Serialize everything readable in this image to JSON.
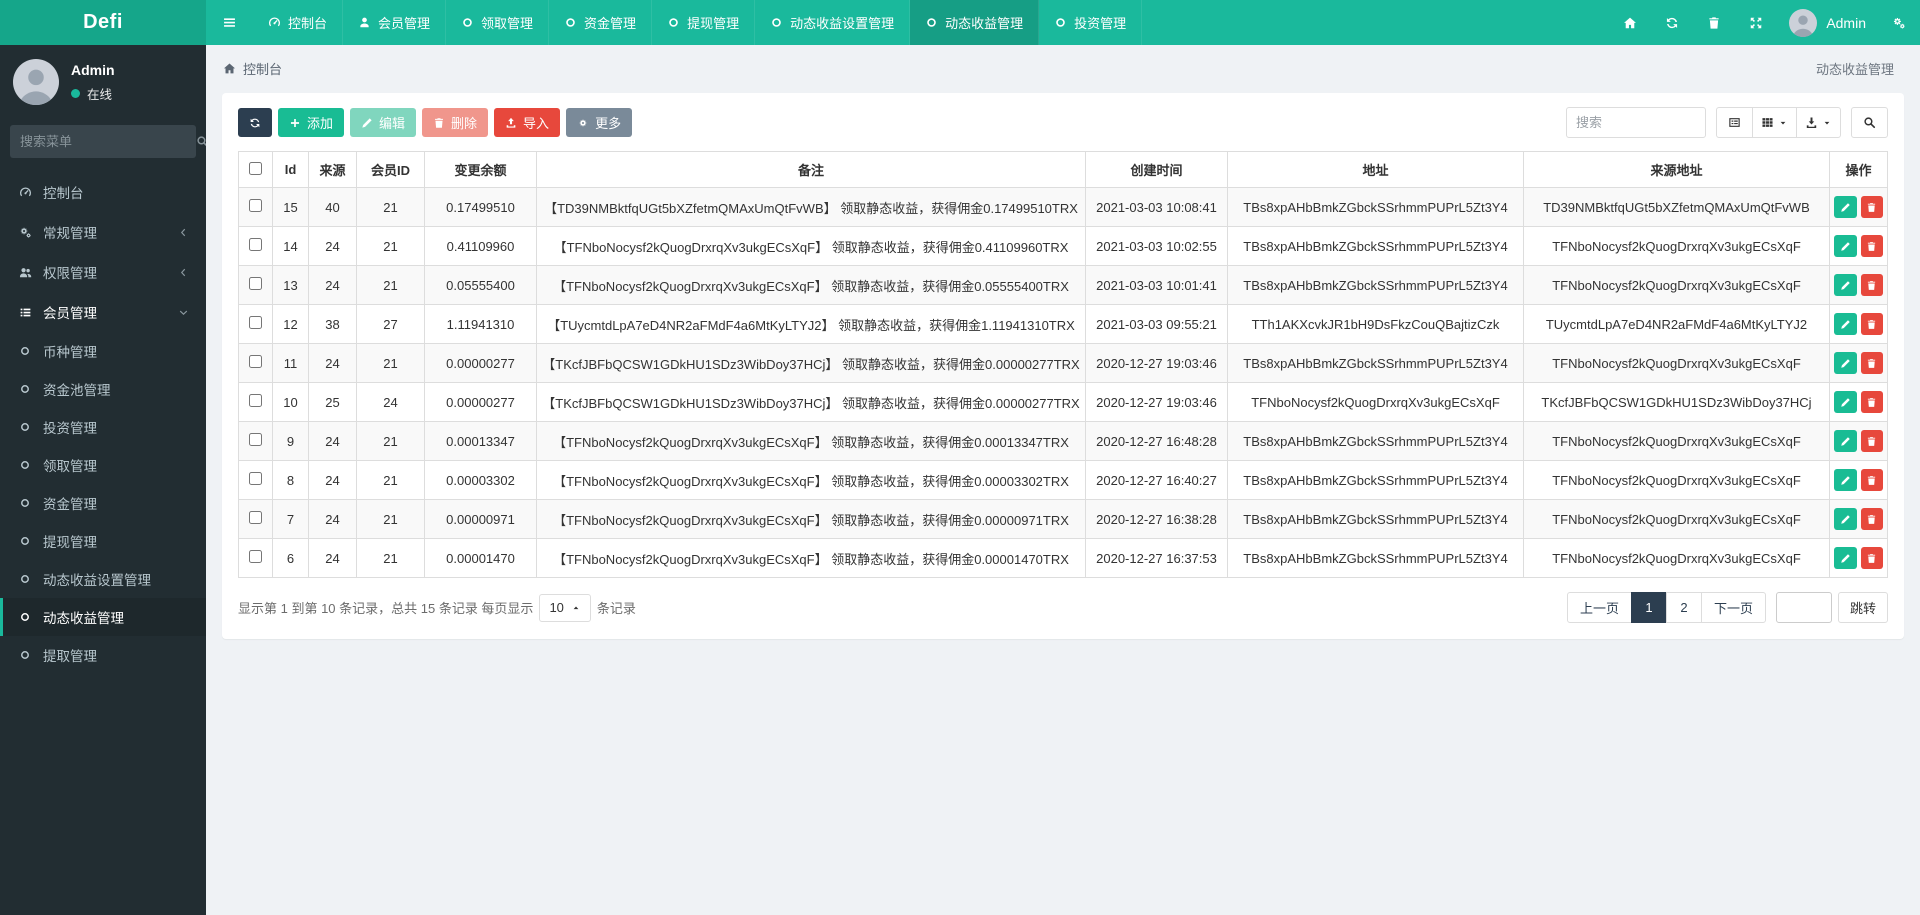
{
  "app": {
    "logo": "Defi"
  },
  "colors": {
    "navbar": "#1ab99c",
    "logo_bg": "#15a68a",
    "nav_active": "#169e85",
    "sidebar": "#222d32",
    "accent": "#19bc94",
    "primary_dark": "#2c3e50",
    "danger": "#e7483c"
  },
  "navbar": {
    "menu": [
      {
        "name": "dashboard",
        "icon": "dashboard-icon",
        "label": "控制台",
        "active": false
      },
      {
        "name": "member",
        "icon": "user-icon",
        "label": "会员管理",
        "active": false
      },
      {
        "name": "claim",
        "icon": "circle-icon",
        "label": "领取管理",
        "active": false
      },
      {
        "name": "funds",
        "icon": "circle-icon",
        "label": "资金管理",
        "active": false
      },
      {
        "name": "withdraw",
        "icon": "circle-icon",
        "label": "提现管理",
        "active": false
      },
      {
        "name": "dynamic-income-settings",
        "icon": "circle-icon",
        "label": "动态收益设置管理",
        "active": false
      },
      {
        "name": "dynamic-income",
        "icon": "circle-icon",
        "label": "动态收益管理",
        "active": true
      },
      {
        "name": "invest",
        "icon": "circle-icon",
        "label": "投资管理",
        "active": false
      }
    ],
    "user": "Admin"
  },
  "sidebar": {
    "user_name": "Admin",
    "user_status": "在线",
    "search_placeholder": "搜索菜单",
    "menu": [
      {
        "name": "dashboard",
        "type": "top",
        "icon": "dashboard-icon",
        "label": "控制台"
      },
      {
        "name": "general",
        "type": "top",
        "icon": "cogs-icon",
        "label": "常规管理",
        "chevron": "left"
      },
      {
        "name": "auth",
        "type": "top",
        "icon": "users-icon",
        "label": "权限管理",
        "chevron": "left"
      },
      {
        "name": "member",
        "type": "top",
        "icon": "list-icon",
        "label": "会员管理",
        "chevron": "down",
        "open": true
      },
      {
        "name": "currency",
        "type": "sub",
        "label": "币种管理"
      },
      {
        "name": "pool",
        "type": "sub",
        "label": "资金池管理"
      },
      {
        "name": "invest",
        "type": "sub",
        "label": "投资管理"
      },
      {
        "name": "claim",
        "type": "sub",
        "label": "领取管理"
      },
      {
        "name": "funds",
        "type": "sub",
        "label": "资金管理"
      },
      {
        "name": "withdraw",
        "type": "sub",
        "label": "提现管理"
      },
      {
        "name": "dynamic-income-settings",
        "type": "sub",
        "label": "动态收益设置管理"
      },
      {
        "name": "dynamic-income",
        "type": "sub",
        "label": "动态收益管理",
        "active": true
      },
      {
        "name": "extract",
        "type": "sub",
        "label": "提取管理"
      }
    ]
  },
  "breadcrumb": {
    "home_label": "控制台"
  },
  "page": {
    "title_right": "动态收益管理"
  },
  "toolbar": {
    "buttons": [
      {
        "name": "refresh",
        "icon": "refresh-icon",
        "label": "",
        "style": "dark"
      },
      {
        "name": "add",
        "icon": "plus-icon",
        "label": "添加",
        "style": "success"
      },
      {
        "name": "edit",
        "icon": "pencil-icon",
        "label": "编辑",
        "style": "success-light"
      },
      {
        "name": "delete",
        "icon": "trash-icon",
        "label": "删除",
        "style": "danger-light"
      },
      {
        "name": "import",
        "icon": "upload-icon",
        "label": "导入",
        "style": "danger"
      },
      {
        "name": "more",
        "icon": "gear-icon",
        "label": "更多",
        "style": "gray"
      }
    ],
    "search_placeholder": "搜索"
  },
  "table": {
    "columns": [
      "Id",
      "来源",
      "会员ID",
      "变更余额",
      "备注",
      "创建时间",
      "地址",
      "来源地址",
      "操作"
    ],
    "rows": [
      {
        "id": "15",
        "source": "40",
        "member_id": "21",
        "amount": "0.17499510",
        "remark": "【TD39NMBktfqUGt5bXZfetmQMAxUmQtFvWB】 领取静态收益，获得佣金0.17499510TRX",
        "created": "2021-03-03 10:08:41",
        "address": "TBs8xpAHbBmkZGbckSSrhmmPUPrL5Zt3Y4",
        "from_address": "TD39NMBktfqUGt5bXZfetmQMAxUmQtFvWB"
      },
      {
        "id": "14",
        "source": "24",
        "member_id": "21",
        "amount": "0.41109960",
        "remark": "【TFNboNocysf2kQuogDrxrqXv3ukgECsXqF】 领取静态收益，获得佣金0.41109960TRX",
        "created": "2021-03-03 10:02:55",
        "address": "TBs8xpAHbBmkZGbckSSrhmmPUPrL5Zt3Y4",
        "from_address": "TFNboNocysf2kQuogDrxrqXv3ukgECsXqF"
      },
      {
        "id": "13",
        "source": "24",
        "member_id": "21",
        "amount": "0.05555400",
        "remark": "【TFNboNocysf2kQuogDrxrqXv3ukgECsXqF】 领取静态收益，获得佣金0.05555400TRX",
        "created": "2021-03-03 10:01:41",
        "address": "TBs8xpAHbBmkZGbckSSrhmmPUPrL5Zt3Y4",
        "from_address": "TFNboNocysf2kQuogDrxrqXv3ukgECsXqF"
      },
      {
        "id": "12",
        "source": "38",
        "member_id": "27",
        "amount": "1.11941310",
        "remark": "【TUycmtdLpA7eD4NR2aFMdF4a6MtKyLTYJ2】 领取静态收益，获得佣金1.11941310TRX",
        "created": "2021-03-03 09:55:21",
        "address": "TTh1AKXcvkJR1bH9DsFkzCouQBajtizCzk",
        "from_address": "TUycmtdLpA7eD4NR2aFMdF4a6MtKyLTYJ2"
      },
      {
        "id": "11",
        "source": "24",
        "member_id": "21",
        "amount": "0.00000277",
        "remark": "【TKcfJBFbQCSW1GDkHU1SDz3WibDoy37HCj】 领取静态收益，获得佣金0.00000277TRX",
        "created": "2020-12-27 19:03:46",
        "address": "TBs8xpAHbBmkZGbckSSrhmmPUPrL5Zt3Y4",
        "from_address": "TFNboNocysf2kQuogDrxrqXv3ukgECsXqF"
      },
      {
        "id": "10",
        "source": "25",
        "member_id": "24",
        "amount": "0.00000277",
        "remark": "【TKcfJBFbQCSW1GDkHU1SDz3WibDoy37HCj】 领取静态收益，获得佣金0.00000277TRX",
        "created": "2020-12-27 19:03:46",
        "address": "TFNboNocysf2kQuogDrxrqXv3ukgECsXqF",
        "from_address": "TKcfJBFbQCSW1GDkHU1SDz3WibDoy37HCj"
      },
      {
        "id": "9",
        "source": "24",
        "member_id": "21",
        "amount": "0.00013347",
        "remark": "【TFNboNocysf2kQuogDrxrqXv3ukgECsXqF】 领取静态收益，获得佣金0.00013347TRX",
        "created": "2020-12-27 16:48:28",
        "address": "TBs8xpAHbBmkZGbckSSrhmmPUPrL5Zt3Y4",
        "from_address": "TFNboNocysf2kQuogDrxrqXv3ukgECsXqF"
      },
      {
        "id": "8",
        "source": "24",
        "member_id": "21",
        "amount": "0.00003302",
        "remark": "【TFNboNocysf2kQuogDrxrqXv3ukgECsXqF】 领取静态收益，获得佣金0.00003302TRX",
        "created": "2020-12-27 16:40:27",
        "address": "TBs8xpAHbBmkZGbckSSrhmmPUPrL5Zt3Y4",
        "from_address": "TFNboNocysf2kQuogDrxrqXv3ukgECsXqF"
      },
      {
        "id": "7",
        "source": "24",
        "member_id": "21",
        "amount": "0.00000971",
        "remark": "【TFNboNocysf2kQuogDrxrqXv3ukgECsXqF】 领取静态收益，获得佣金0.00000971TRX",
        "created": "2020-12-27 16:38:28",
        "address": "TBs8xpAHbBmkZGbckSSrhmmPUPrL5Zt3Y4",
        "from_address": "TFNboNocysf2kQuogDrxrqXv3ukgECsXqF"
      },
      {
        "id": "6",
        "source": "24",
        "member_id": "21",
        "amount": "0.00001470",
        "remark": "【TFNboNocysf2kQuogDrxrqXv3ukgECsXqF】 领取静态收益，获得佣金0.00001470TRX",
        "created": "2020-12-27 16:37:53",
        "address": "TBs8xpAHbBmkZGbckSSrhmmPUPrL5Zt3Y4",
        "from_address": "TFNboNocysf2kQuogDrxrqXv3ukgECsXqF"
      }
    ]
  },
  "pagination": {
    "info_prefix": "显示第 1 到第 10 条记录，总共 15 条记录 每页显示",
    "page_size": "10",
    "info_suffix": "条记录",
    "prev_label": "上一页",
    "pages": [
      "1",
      "2"
    ],
    "active_page": "1",
    "next_label": "下一页",
    "jump_label": "跳转"
  }
}
